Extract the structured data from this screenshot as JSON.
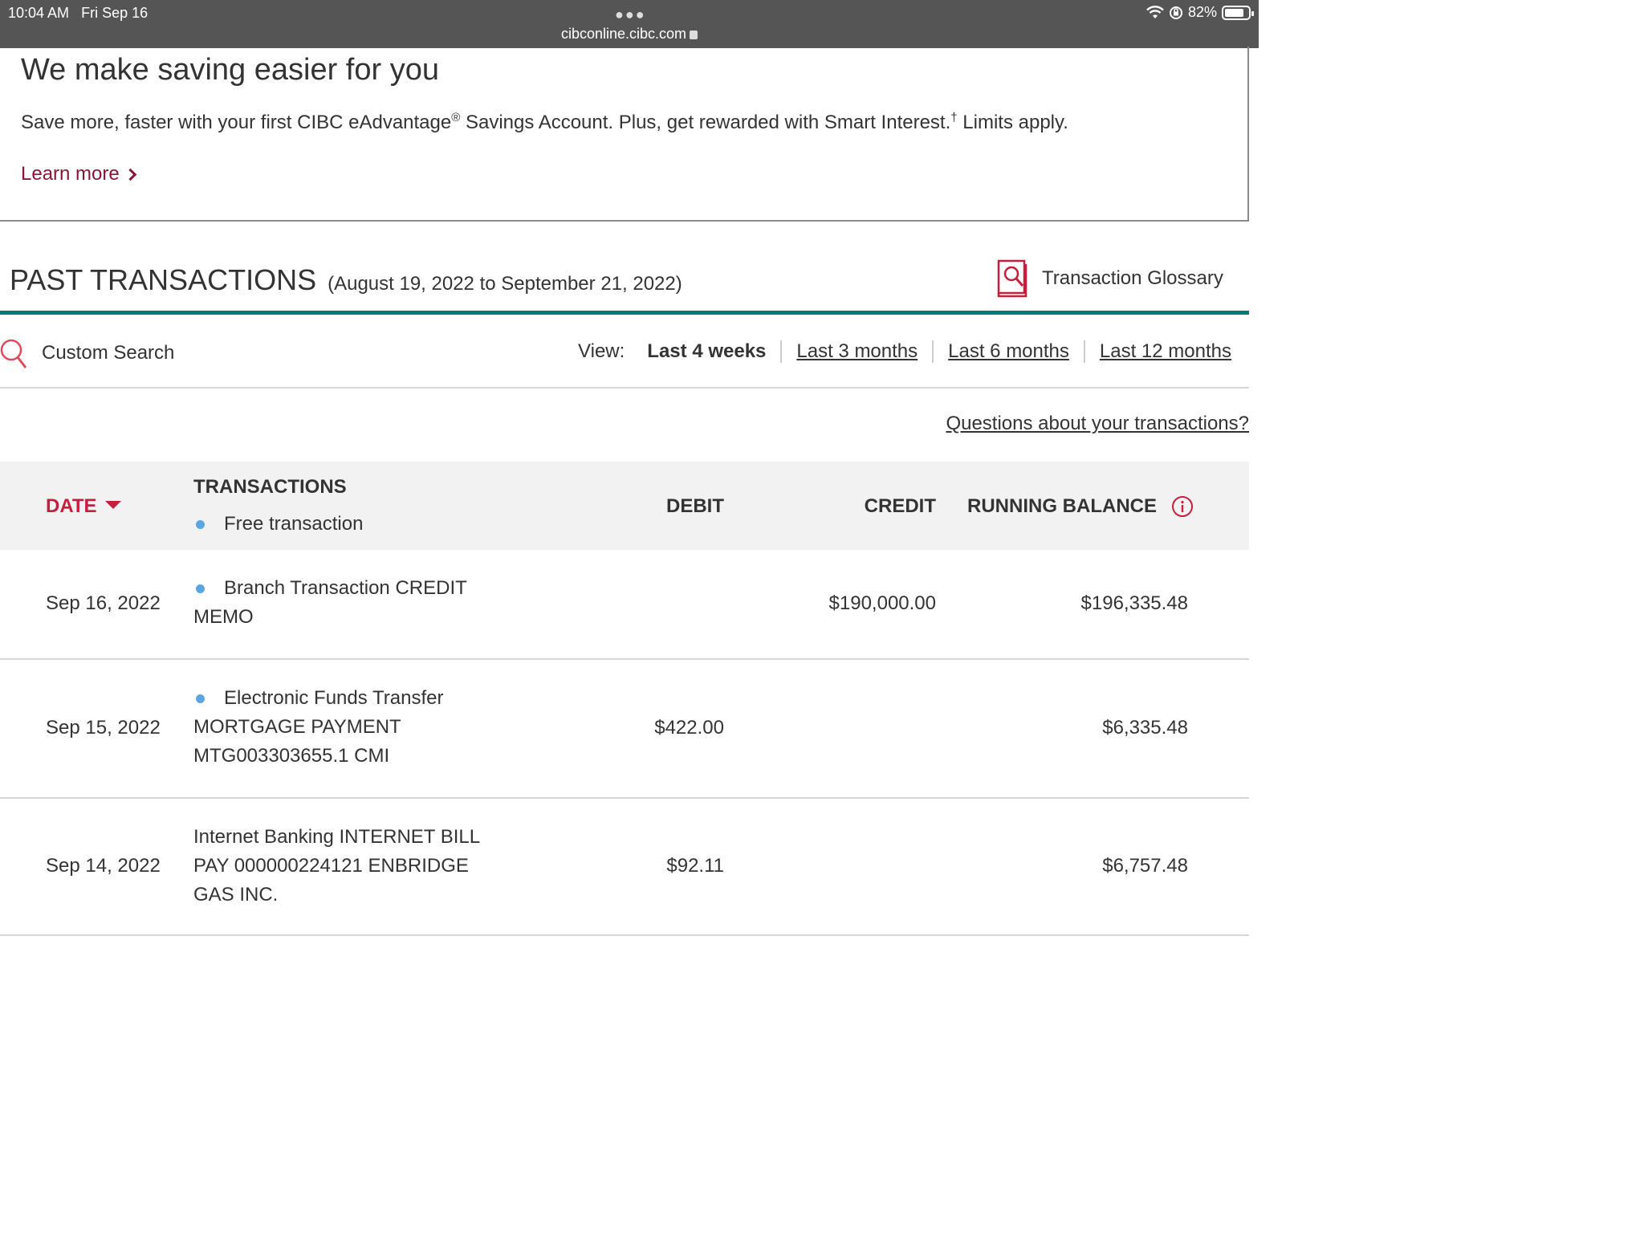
{
  "status_bar": {
    "time": "10:04 AM",
    "date": "Fri Sep 16",
    "url": "cibconline.cibc.com",
    "battery": "82%",
    "battery_level": 0.82
  },
  "promo": {
    "title": "We make saving easier for you",
    "text_part1": "Save more, faster with your first CIBC eAdvantage",
    "text_reg": "®",
    "text_part2": " Savings Account. Plus, get rewarded with Smart Interest.",
    "text_dagger": "†",
    "text_part3": " Limits apply.",
    "link": "Learn more"
  },
  "section": {
    "title": "PAST TRANSACTIONS",
    "range": "(August 19, 2022 to September 21, 2022)",
    "glossary": "Transaction Glossary"
  },
  "search": {
    "label": "Custom Search"
  },
  "view": {
    "label": "View:",
    "options": [
      "Last 4 weeks",
      "Last 3 months",
      "Last 6 months",
      "Last 12 months"
    ],
    "active": "Last 4 weeks"
  },
  "questions_link": "Questions about your transactions?",
  "table": {
    "headers": {
      "date": "DATE",
      "transactions": "TRANSACTIONS",
      "free_legend": "Free transaction",
      "debit": "DEBIT",
      "credit": "CREDIT",
      "balance": "RUNNING BALANCE"
    },
    "rows": [
      {
        "date": "Sep 16, 2022",
        "free": true,
        "desc": [
          "Branch Transaction CREDIT",
          "MEMO"
        ],
        "debit": "",
        "credit": "$190,000.00",
        "balance": "$196,335.48"
      },
      {
        "date": "Sep 15, 2022",
        "free": true,
        "desc": [
          "Electronic Funds Transfer",
          "MORTGAGE PAYMENT",
          "MTG003303655.1 CMI"
        ],
        "debit": "$422.00",
        "credit": "",
        "balance": "$6,335.48"
      },
      {
        "date": "Sep 14, 2022",
        "free": false,
        "desc": [
          "Internet Banking INTERNET BILL",
          "PAY 000000224121 ENBRIDGE",
          "GAS INC."
        ],
        "debit": "$92.11",
        "credit": "",
        "balance": "$6,757.48"
      }
    ]
  },
  "colors": {
    "accent_red": "#c41f3e",
    "link_maroon": "#8b1538",
    "teal": "#007a78",
    "free_dot": "#5aa6e0"
  }
}
